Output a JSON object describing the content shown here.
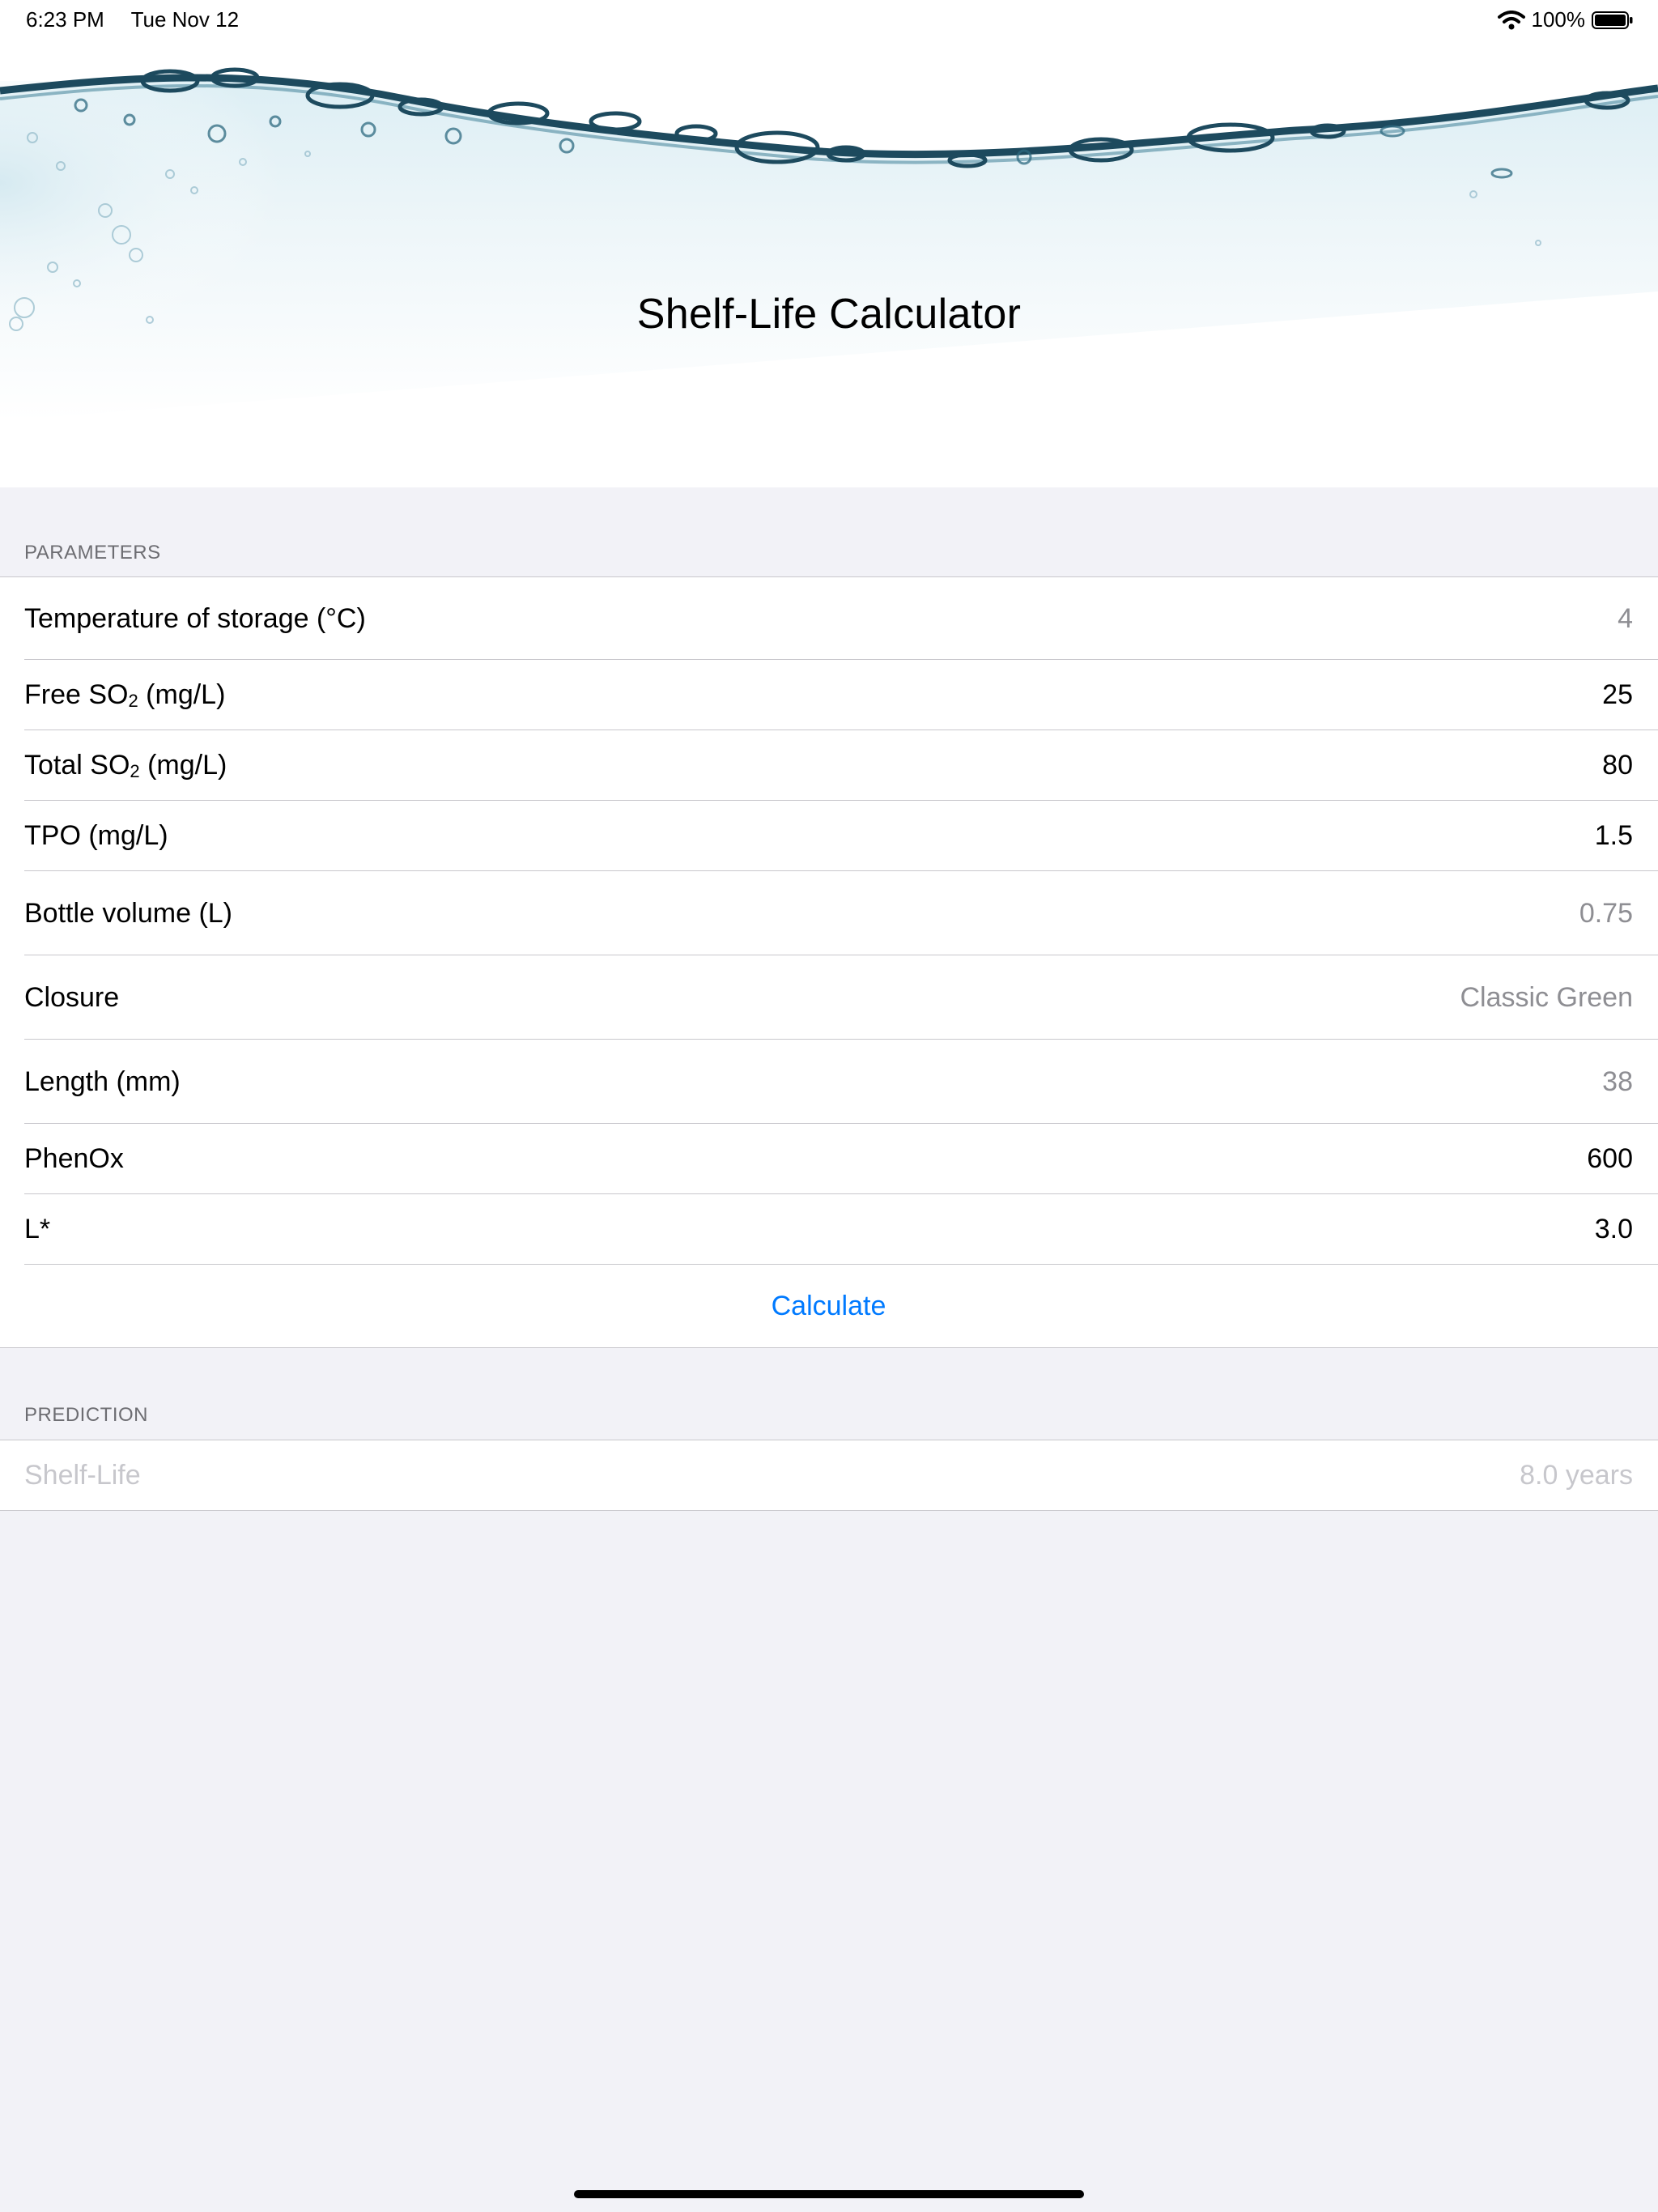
{
  "status_bar": {
    "time": "6:23 PM",
    "date": "Tue Nov 12",
    "battery": "100%"
  },
  "header": {
    "title": "Shelf-Life Calculator"
  },
  "parameters": {
    "section_title": "PARAMETERS",
    "rows": {
      "temperature": {
        "label": "Temperature of storage (°C)",
        "value": "4"
      },
      "free_so2": {
        "label_pre": "Free SO",
        "label_sub": "2",
        "label_post": " (mg/L)",
        "value": "25"
      },
      "total_so2": {
        "label_pre": "Total SO",
        "label_sub": "2",
        "label_post": " (mg/L)",
        "value": "80"
      },
      "tpo": {
        "label": "TPO (mg/L)",
        "value": "1.5"
      },
      "bottle_volume": {
        "label": "Bottle volume (L)",
        "value": "0.75"
      },
      "closure": {
        "label": "Closure",
        "value": "Classic Green"
      },
      "length": {
        "label": "Length (mm)",
        "value": "38"
      },
      "phenox": {
        "label": "PhenOx",
        "value": "600"
      },
      "lstar": {
        "label": "L*",
        "value": "3.0"
      }
    },
    "calculate_label": "Calculate"
  },
  "prediction": {
    "section_title": "PREDICTION",
    "label": "Shelf-Life",
    "value": "8.0 years"
  },
  "colors": {
    "accent": "#007aff",
    "background": "#f2f2f7",
    "water": "#1d4a5e"
  },
  "icons": [
    "wifi-icon",
    "battery-icon"
  ]
}
